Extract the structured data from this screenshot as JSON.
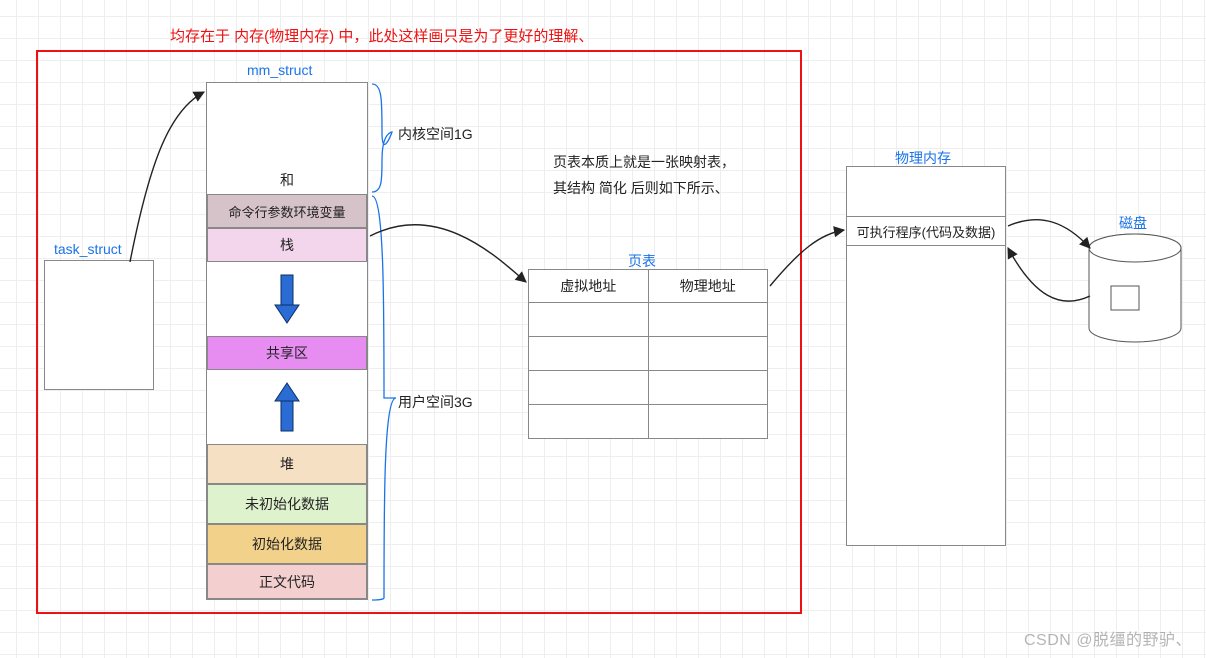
{
  "annotation_top": "均存在于 内存(物理内存) 中，此处这样画只是为了更好的理解、",
  "task_struct": {
    "title": "task_struct"
  },
  "mm_struct": {
    "title": "mm_struct",
    "sep_label": "和",
    "segments": {
      "cmdline_env": "命令行参数环境变量",
      "stack": "栈",
      "shared": "共享区",
      "heap": "堆",
      "bss": "未初始化数据",
      "data": "初始化数据",
      "text": "正文代码"
    },
    "brace_kernel": "内核空间1G",
    "brace_user": "用户空间3G"
  },
  "page_table": {
    "title": "页表",
    "desc_line1": "页表本质上就是一张映射表，",
    "desc_line2": "其结构 简化 后则如下所示、",
    "col_virtual": "虚拟地址",
    "col_physical": "物理地址"
  },
  "phys_mem": {
    "title": "物理内存",
    "exe_label": "可执行程序(代码及数据)"
  },
  "disk": {
    "title": "磁盘"
  },
  "watermark": "CSDN @脱缰的野驴、"
}
